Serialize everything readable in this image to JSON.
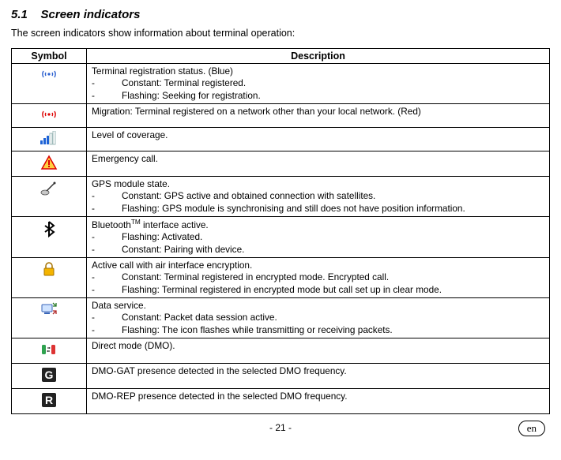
{
  "heading_number": "5.1",
  "heading_title": "Screen indicators",
  "intro_text": "The screen indicators show information about terminal operation:",
  "table": {
    "col1": "Symbol",
    "col2": "Description",
    "rows": [
      {
        "icon": "signal-blue",
        "lead": "Terminal registration status. (Blue)",
        "bullets": [
          "Constant: Terminal registered.",
          "Flashing: Seeking for registration."
        ]
      },
      {
        "icon": "signal-red",
        "lead": "Migration: Terminal registered on a network other than your local network. (Red)"
      },
      {
        "icon": "coverage",
        "lead": "Level of coverage."
      },
      {
        "icon": "emergency",
        "lead": "Emergency call."
      },
      {
        "icon": "gps",
        "lead": "GPS module state.",
        "bullets": [
          "Constant: GPS active and obtained connection with satellites.",
          "Flashing: GPS module is synchronising and still does not have position information."
        ]
      },
      {
        "icon": "bluetooth",
        "lead_html": "Bluetooth<sup>TM</sup> interface active.",
        "bullets": [
          "Flashing: Activated.",
          "Constant: Pairing with device."
        ]
      },
      {
        "icon": "encrypted",
        "lead": "Active call with air interface encryption.",
        "bullets": [
          "Constant: Terminal registered in encrypted mode. Encrypted call.",
          "Flashing: Terminal registered in encrypted mode but call set up in clear mode."
        ]
      },
      {
        "icon": "data",
        "lead": "Data service.",
        "bullets": [
          "Constant: Packet data session active.",
          "Flashing: The icon flashes while transmitting or receiving packets."
        ]
      },
      {
        "icon": "dmo",
        "lead": "Direct mode (DMO)."
      },
      {
        "icon": "dmo-gat",
        "lead": "DMO-GAT presence detected in the selected DMO frequency."
      },
      {
        "icon": "dmo-rep",
        "lead": "DMO-REP presence detected in the selected DMO frequency."
      }
    ]
  },
  "page_number": "- 21 -",
  "lang": "en"
}
